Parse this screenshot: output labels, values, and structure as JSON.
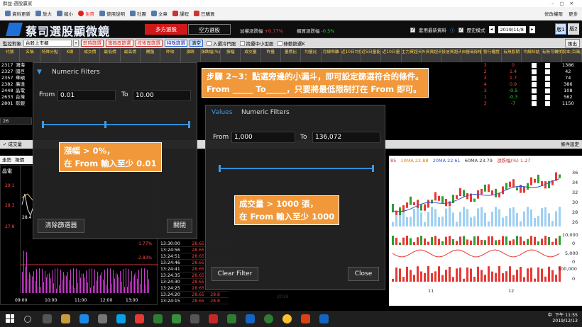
{
  "window_title": "群益-選股贏家",
  "menu": {
    "items": [
      "資料更新",
      "放大",
      "縮小",
      "會員",
      "使用說明",
      "社團",
      "文章",
      "課程",
      "已購買"
    ],
    "right": [
      "修改權限",
      "更多"
    ],
    "badge": "免費"
  },
  "app": {
    "name": "蔡司選股顯微鏡",
    "tab_long": "多方選股",
    "tab_short": "空方選股",
    "idx1_label": "加權漲跌幅",
    "idx1_value": "+0.77%",
    "idx2_label": "櫃買漲跌幅",
    "idx2_value": "-0.5%",
    "use_latest": "套用最新資料",
    "history_mode": "歷史模式",
    "date": "2019/11/8",
    "view1": "版1",
    "view2": "版2"
  },
  "toolbar": {
    "monitor_label": "監控對象",
    "monitor_value": "台股上市櫃",
    "buttons": [
      "即時篩選",
      "籌碼面篩選",
      "技術面篩選",
      "特殊篩選"
    ],
    "clear": "清空",
    "options": [
      "入選冷門股",
      "找優中小型股",
      "條動篩選K"
    ],
    "export": "匯出"
  },
  "columns": [
    "代號",
    "名稱",
    "特殊分點",
    "K線",
    "成交價",
    "最低價",
    "最高價",
    "開盤",
    "昨收",
    "漲跌",
    "漲跌幅(%)",
    "振幅",
    "成交量",
    "昨量",
    "量價比",
    "均量比",
    "月線乖離",
    "近10日均價乖離",
    "近5日量能",
    "近10日量",
    "主力買超天數",
    "外資買超天數",
    "投信買超天數",
    "自營商除權",
    "發行權證",
    "有無股期",
    "均線糾結",
    "有無可轉債",
    "股本(百萬)"
  ],
  "rows_left": [
    {
      "code": "2317",
      "name": "鴻海"
    },
    {
      "code": "2327",
      "name": "國巨"
    },
    {
      "code": "2357",
      "name": "華碩"
    },
    {
      "code": "2382",
      "name": "廣達"
    },
    {
      "code": "2448",
      "name": "晶電"
    },
    {
      "code": "2633",
      "name": "台灣"
    },
    {
      "code": "2801",
      "name": "彰銀"
    }
  ],
  "rows_right": [
    {
      "c1": "3",
      "c2": "0",
      "cap": "1386"
    },
    {
      "c1": "2",
      "c2": "1.4",
      "cap": "42"
    },
    {
      "c1": "3",
      "c2": "1.7",
      "cap": "74"
    },
    {
      "c1": "4",
      "c2": "0.9",
      "cap": "386"
    },
    {
      "c1": "3",
      "c2": "-0.5",
      "cap": "108"
    },
    {
      "c1": "1",
      "c2": "-0.3",
      "cap": "562"
    },
    {
      "c1": "3",
      "c2": "-7",
      "cap": "1150"
    }
  ],
  "page_count": "26",
  "subbar": {
    "left": "✓ 成交量",
    "right": "條件設定"
  },
  "left_tabs": "走勢 報價",
  "left_chart": {
    "stock": "晶電",
    "prices": [
      "29.1",
      "28.3",
      "27.8",
      "28.4"
    ],
    "pct": [
      "-1.77%",
      "-2.83%"
    ],
    "times": [
      "09:00",
      "10:00",
      "11:00",
      "12:00",
      "13:00"
    ]
  },
  "ticks": [
    {
      "t": "13:30:00",
      "p": "28.65",
      "v": ""
    },
    {
      "t": "13:24:56",
      "p": "28.65",
      "v": ""
    },
    {
      "t": "13:24:51",
      "p": "28.65",
      "v": ""
    },
    {
      "t": "13:24:46",
      "p": "28.65",
      "v": ""
    },
    {
      "t": "13:24:41",
      "p": "28.65",
      "v": ""
    },
    {
      "t": "13:24:35",
      "p": "28.65",
      "v": ""
    },
    {
      "t": "13:24:30",
      "p": "28.65",
      "v": ""
    },
    {
      "t": "13:24:25",
      "p": "28.65",
      "v": ""
    },
    {
      "t": "13:24:20",
      "p": "28.65",
      "v": "28.8"
    },
    {
      "t": "13:24:15",
      "p": "28.65",
      "v": "28.8"
    }
  ],
  "main_chart": {
    "legend": {
      "ma5": "85",
      "ma10": "10MA 22.88",
      "ma20": "20MA 22.61",
      "ma60": "60MA 23.79",
      "chg": "漲跌幅(%) 1.27"
    },
    "y_price": [
      "36",
      "34",
      "32",
      "30",
      "28",
      "26"
    ],
    "y_vol": [
      "10,000",
      "0"
    ],
    "y_amt": [
      "5,000",
      "0"
    ],
    "y_turn": [
      "300,000",
      "0"
    ],
    "x_labels": [
      "11",
      "12"
    ],
    "year": "2019"
  },
  "filter1": {
    "title": "Numeric Filters",
    "from_label": "From",
    "to_label": "To",
    "from_value": "0.01",
    "to_value": "10.00",
    "clear": "清除篩選器",
    "close": "關閉"
  },
  "filter2": {
    "tab_values": "Values",
    "tab_numeric": "Numeric Filters",
    "from_label": "From",
    "to_label": "To",
    "from_value": "1,000",
    "to_value": "136,072",
    "clear": "Clear Filter",
    "close": "Close"
  },
  "note_top": {
    "line1": "步驟 2~3：點選旁邊的小漏斗，即可設定篩選符合的條件。",
    "line2": "From _____ To_____，只要將最低限制打在 From 即可。"
  },
  "note_left": {
    "line1": "漲幅 > 0%，",
    "line2": "在 From 輸入至少 0.01"
  },
  "note_mid": {
    "line1": "成交量 > 1000 張，",
    "line2": "在 From 輸入至少 1000"
  },
  "tray": {
    "time": "下午 11:55",
    "date": "2019/12/13",
    "lang": "中"
  },
  "colors": {
    "accent_blue": "#2f8dd6",
    "note_orange": "#f0983a",
    "long_red": "#d01a1a"
  }
}
